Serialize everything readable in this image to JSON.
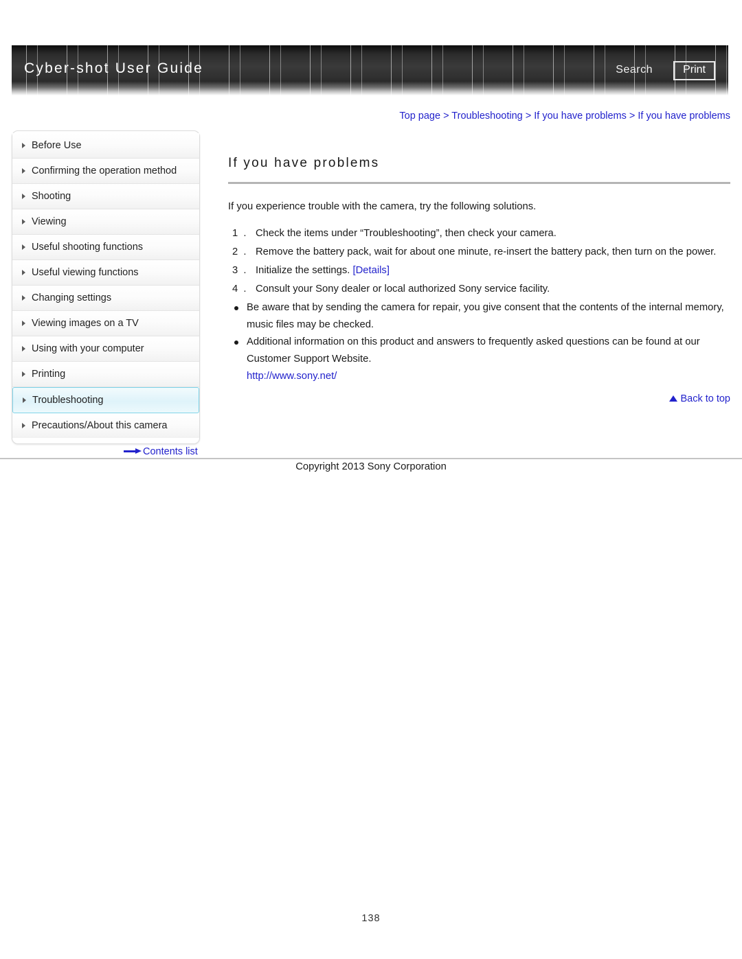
{
  "header": {
    "title": "Cyber-shot User Guide",
    "search_label": "Search",
    "print_label": "Print"
  },
  "breadcrumb": {
    "text": "Top page > Troubleshooting > If you have problems > If you have problems"
  },
  "sidebar": {
    "items": [
      {
        "label": "Before Use",
        "active": false
      },
      {
        "label": "Confirming the operation method",
        "active": false
      },
      {
        "label": "Shooting",
        "active": false
      },
      {
        "label": "Viewing",
        "active": false
      },
      {
        "label": "Useful shooting functions",
        "active": false
      },
      {
        "label": "Useful viewing functions",
        "active": false
      },
      {
        "label": "Changing settings",
        "active": false
      },
      {
        "label": "Viewing images on a TV",
        "active": false
      },
      {
        "label": "Using with your computer",
        "active": false
      },
      {
        "label": "Printing",
        "active": false
      },
      {
        "label": "Troubleshooting",
        "active": true
      },
      {
        "label": "Precautions/About this camera",
        "active": false
      }
    ],
    "contents_list_label": "Contents list"
  },
  "main": {
    "title": "If you have problems",
    "intro": "If you experience trouble with the camera, try the following solutions.",
    "steps": [
      {
        "num": "1 .",
        "text": "Check the items under “Troubleshooting”, then check your camera.",
        "link": ""
      },
      {
        "num": "2 .",
        "text": "Remove the battery pack, wait for about one minute, re-insert the battery pack, then turn on the power.",
        "link": ""
      },
      {
        "num": "3 .",
        "text": "Initialize the settings.",
        "link": "[Details]"
      },
      {
        "num": "4 .",
        "text": "Consult your Sony dealer or local authorized Sony service facility.",
        "link": ""
      }
    ],
    "bullets": [
      "Be aware that by sending the camera for repair, you give consent that the contents of the internal memory, music files may be checked.",
      "Additional information on this product and answers to frequently asked questions can be found at our Customer Support Website."
    ],
    "url": "http://www.sony.net/",
    "back_to_top_label": "Back to top"
  },
  "footer": {
    "copyright": "Copyright 2013 Sony Corporation",
    "page_number": "138"
  }
}
